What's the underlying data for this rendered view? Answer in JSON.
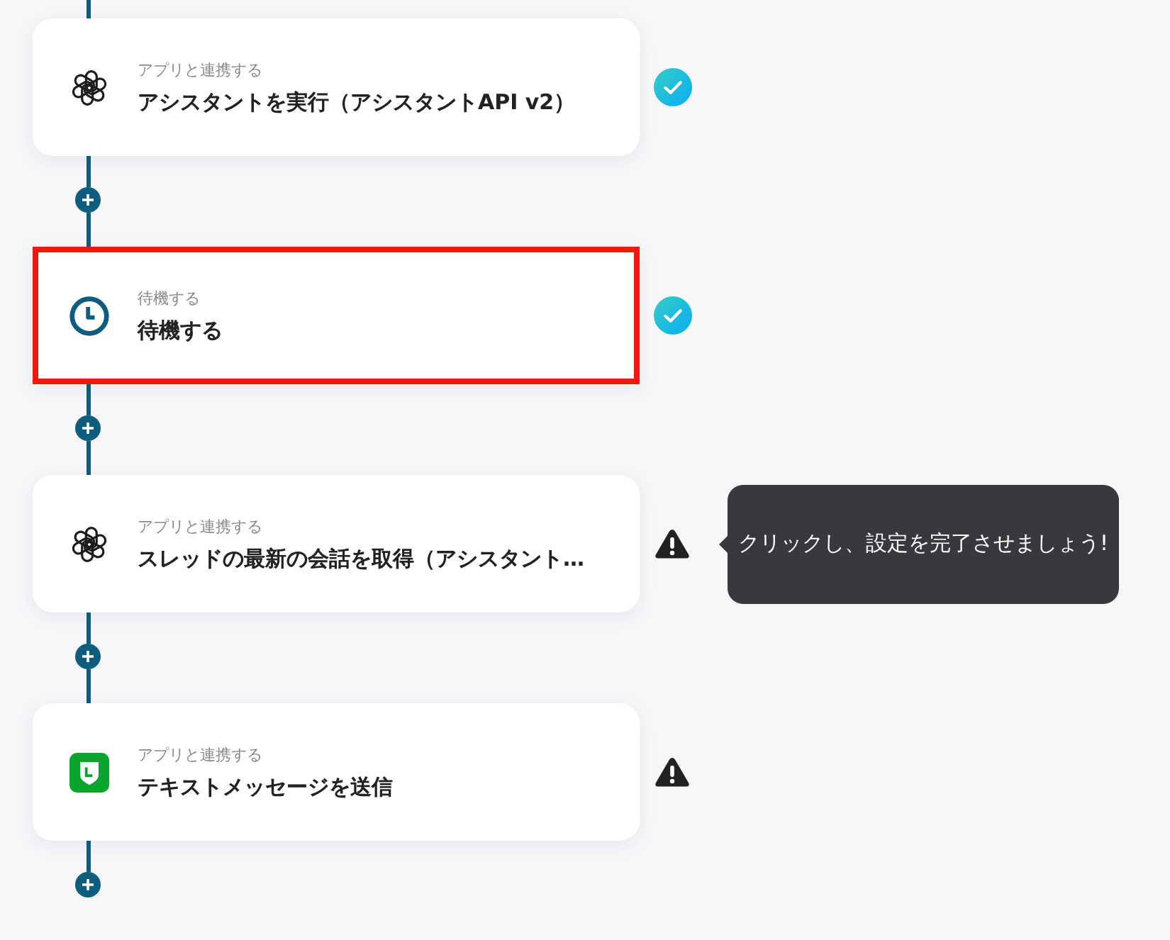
{
  "steps": [
    {
      "kind": "assistant",
      "category": "アプリと連携する",
      "title": "アシスタントを実行（アシスタントAPI v2）",
      "completed": true,
      "selected": false
    },
    {
      "kind": "wait",
      "category": "待機する",
      "title": "待機する",
      "completed": true,
      "selected": true
    },
    {
      "kind": "assistant",
      "category": "アプリと連携する",
      "title": "スレッドの最新の会話を取得（アシスタント…",
      "completed": false,
      "selected": false,
      "tooltip": "クリックし、設定を完了させましょう!"
    },
    {
      "kind": "messaging",
      "category": "アプリと連携する",
      "title": "テキストメッセージを送信",
      "completed": false,
      "selected": false
    }
  ]
}
